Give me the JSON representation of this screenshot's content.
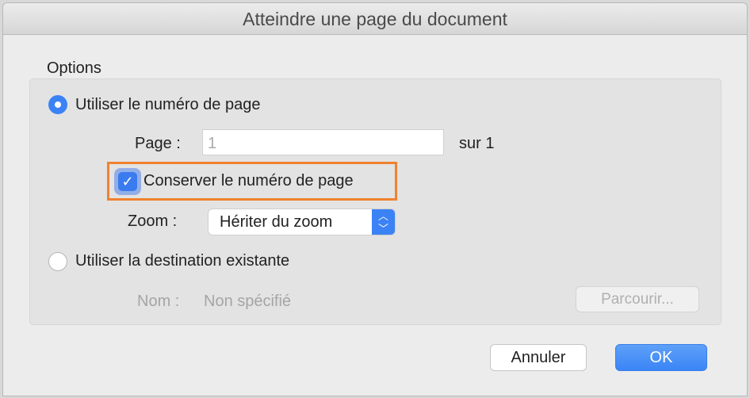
{
  "dialog": {
    "title": "Atteindre une page du document"
  },
  "options": {
    "group_label": "Options",
    "radio_page_label": "Utiliser le numéro de page",
    "page_label": "Page :",
    "page_value": "1",
    "page_total": "sur 1",
    "keep_page_label": "Conserver le numéro de page",
    "keep_page_checked": true,
    "zoom_label": "Zoom :",
    "zoom_value": "Hériter du zoom",
    "radio_dest_label": "Utiliser la destination existante",
    "name_label": "Nom :",
    "name_value": "Non spécifié",
    "browse_label": "Parcourir..."
  },
  "buttons": {
    "cancel": "Annuler",
    "ok": "OK"
  }
}
